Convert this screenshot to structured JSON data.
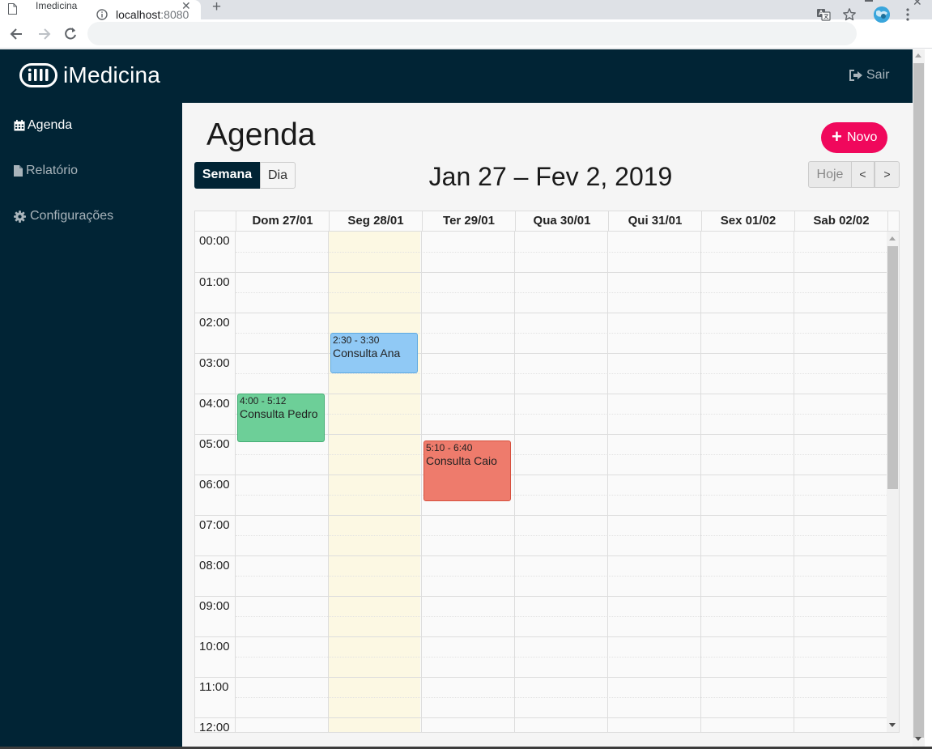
{
  "browser": {
    "tab_title": "Imedicina",
    "close_glyph": "✕",
    "new_tab_glyph": "+",
    "url_host": "localhost",
    "url_port": ":8080"
  },
  "app": {
    "brand": "iMedicina",
    "logout_label": "Sair"
  },
  "sidebar": {
    "items": [
      {
        "label": "Agenda",
        "icon": "calendar-icon",
        "active": true
      },
      {
        "label": "Relatório",
        "icon": "file-icon",
        "active": false
      },
      {
        "label": "Configurações",
        "icon": "gear-icon",
        "active": false
      }
    ]
  },
  "main": {
    "title": "Agenda",
    "new_button": "Novo",
    "new_button_icon": "+",
    "views": {
      "week": "Semana",
      "day": "Dia"
    },
    "active_view": "week",
    "date_range": "Jan 27 – Fev 2, 2019",
    "today_button": "Hoje",
    "prev_button": "<",
    "next_button": ">"
  },
  "calendar": {
    "days": [
      "Dom 27/01",
      "Seg 28/01",
      "Ter 29/01",
      "Qua 30/01",
      "Qui 31/01",
      "Sex 01/02",
      "Sab 02/02"
    ],
    "today_index": 1,
    "hours": [
      "00:00",
      "01:00",
      "02:00",
      "03:00",
      "04:00",
      "05:00",
      "06:00",
      "07:00",
      "08:00",
      "09:00",
      "10:00",
      "11:00",
      "12:00"
    ],
    "events": [
      {
        "day": 1,
        "time": "2:30 - 3:30",
        "title": "Consulta Ana",
        "start": 2.5,
        "end": 3.5,
        "color": "#90c9f5",
        "border": "#5ea9e0"
      },
      {
        "day": 0,
        "time": "4:00 - 5:12",
        "title": "Consulta Pedro",
        "start": 4.0,
        "end": 5.2,
        "color": "#6dcf98",
        "border": "#44ad75"
      },
      {
        "day": 2,
        "time": "5:10 - 6:40",
        "title": "Consulta Caio",
        "start": 5.1667,
        "end": 6.6667,
        "color": "#ee7b6c",
        "border": "#d6503e"
      }
    ]
  },
  "colors": {
    "header_bg": "#012435",
    "accent": "#f0085c",
    "today_bg": "#fcf8e3"
  }
}
